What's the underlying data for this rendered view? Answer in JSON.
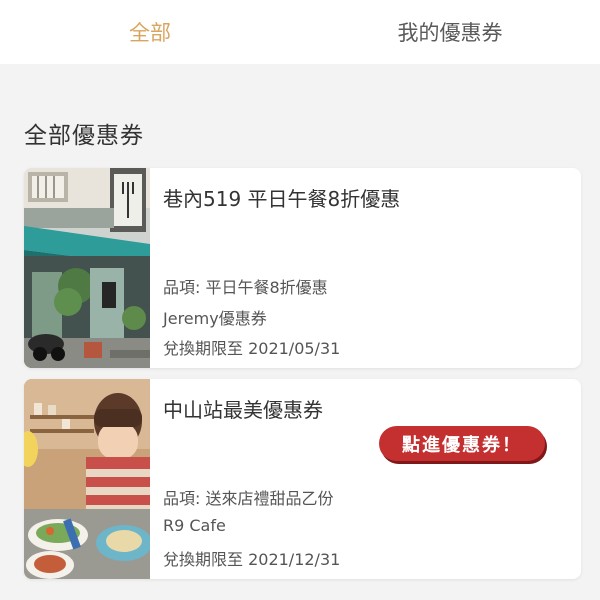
{
  "tabs": [
    {
      "label": "全部",
      "active": true
    },
    {
      "label": "我的優惠券",
      "active": false
    }
  ],
  "section_title": "全部優惠券",
  "coupons": [
    {
      "title": "巷內519 平日午餐8折優惠",
      "item": "品項: 平日午餐8折優惠",
      "vendor": "Jeremy優惠券",
      "expiry": "兌換期限至 2021/05/31"
    },
    {
      "title": "中山站最美優惠券",
      "item": "品項: 送來店禮甜品乙份",
      "vendor": "R9 Cafe",
      "expiry": "兌換期限至 2021/12/31",
      "cta": "點進優惠券！"
    }
  ],
  "colors": {
    "active_tab": "#d9a55e",
    "cta_background": "#c42f30"
  }
}
